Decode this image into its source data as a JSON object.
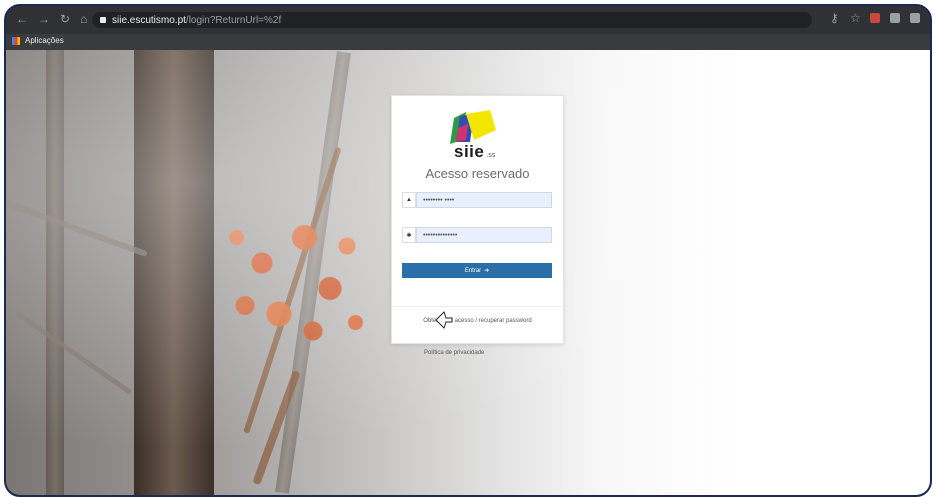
{
  "browser": {
    "url_host": "siie.escutismo.pt",
    "url_path": "/login?ReturnUrl=%2f",
    "bookmarks_label": "Aplicações"
  },
  "icons": [
    "back-icon",
    "forward-icon",
    "reload-icon",
    "home-icon",
    "lock-icon",
    "key-icon",
    "star-icon",
    "extension-icon",
    "apps-icon",
    "user-icon",
    "password-icon",
    "login-icon",
    "cursor-icon"
  ],
  "colors": {
    "primary_button": "#2a6fa8",
    "input_autofill": "#e8f0fe",
    "frame_border": "#1b2a55"
  },
  "login": {
    "brand": "siie",
    "brand_suffix": ".ss",
    "heading": "Acesso reservado",
    "username_value": "•••••••• ••••",
    "password_value": "••••••••••••••",
    "submit_label": "Entrar",
    "recover_link": "Obter novo acesso / recuperar password"
  },
  "footer": {
    "privacy_link": "Política de privacidade"
  }
}
